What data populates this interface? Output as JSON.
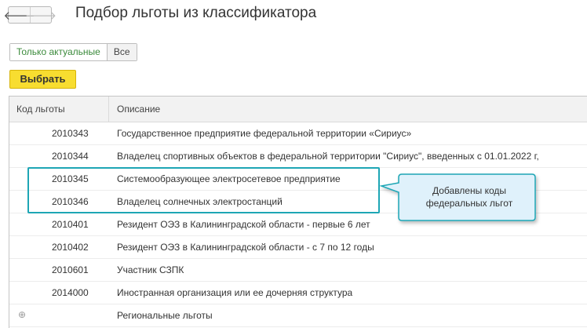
{
  "header": {
    "title": "Подбор льготы из классификатора",
    "back_glyph": "🡐",
    "forward_glyph": "🡒"
  },
  "filter": {
    "options": [
      "Только актуальные",
      "Все"
    ],
    "selected": "Только актуальные"
  },
  "toolbar": {
    "select_label": "Выбрать"
  },
  "table": {
    "columns": [
      "Код льготы",
      "Описание"
    ],
    "rows": [
      {
        "code": "2010343",
        "description": "Государственное предприятие федеральной территории «Сириус»"
      },
      {
        "code": "2010344",
        "description": "Владелец спортивных объектов в федеральной территории \"Сириус\", введенных с 01.01.2022 г,"
      },
      {
        "code": "2010345",
        "description": "Системообразующее электросетевое предприятие"
      },
      {
        "code": "2010346",
        "description": "Владелец солнечных электростанций"
      },
      {
        "code": "2010401",
        "description": "Резидент ОЭЗ в Калининградской области - первые 6 лет"
      },
      {
        "code": "2010402",
        "description": "Резидент ОЭЗ в Калининградской области - с 7 по 12 годы"
      },
      {
        "code": "2010601",
        "description": "Участник СЗПК"
      },
      {
        "code": "2014000",
        "description": "Иностранная организация или ее дочерняя структура"
      },
      {
        "code": "",
        "description": "Региональные льготы",
        "expand_glyph": "⊕"
      }
    ]
  },
  "callout": {
    "text": "Добавлены коды федеральных льгот",
    "border_color": "#1ea6b5",
    "fill_color": "#dff1fb"
  },
  "colors": {
    "accent_button": "#f8dd30",
    "active_filter_text": "#3b8a3b",
    "highlight": "#1ea6b5"
  }
}
